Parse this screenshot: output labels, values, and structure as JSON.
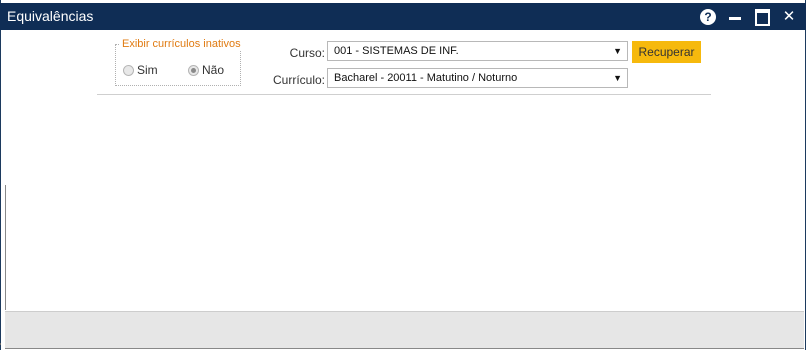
{
  "window": {
    "title": "Equivalências"
  },
  "titlebar_icons": [
    "help-icon",
    "minimize-icon",
    "maximize-icon",
    "close-icon"
  ],
  "filter": {
    "legend": "Exibir currículos inativos",
    "options": [
      {
        "label": "Sim",
        "checked": false
      },
      {
        "label": "Não",
        "checked": true
      }
    ]
  },
  "form": {
    "curso_label": "Curso:",
    "curso_value": "001 - SISTEMAS DE INF.",
    "curriculo_label": "Currículo:",
    "curriculo_value": "Bacharel - 20011 - Matutino / Noturno",
    "recuperar_label": "Recuperar"
  },
  "colors": {
    "titlebar": "#0f2d55",
    "accent_button": "#f6b90d",
    "legend_text": "#e07b12",
    "footer": "#e6e6e6"
  }
}
